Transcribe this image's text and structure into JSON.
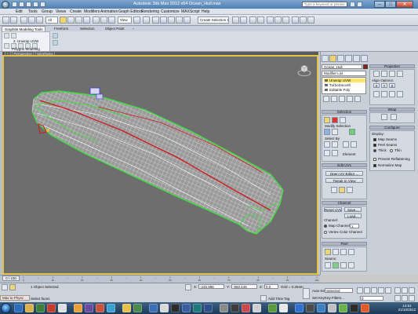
{
  "window": {
    "title": "Autodesk 3ds Max 2012 x64    Ocean_Hull.max",
    "search_placeholder": "Type a keyword or phrase",
    "controls": {
      "minimize": "–",
      "maximize": "□",
      "close": "✕"
    }
  },
  "menu": {
    "items": [
      "Edit",
      "Tools",
      "Group",
      "Views",
      "Create",
      "Modifiers",
      "Animation",
      "Graph Editors",
      "Rendering",
      "Customize",
      "MAXScript",
      "Help"
    ]
  },
  "toolbar": {
    "filter_select": "All",
    "view_select": "View",
    "selection_set": "Create Selection Se"
  },
  "ribbon": {
    "tabs": [
      "Graphite Modeling Tools",
      "Freeform",
      "Selection",
      "Object Paint"
    ],
    "panel_label": "Polygon Modeling",
    "panel_value": "2. Unwrap UVW"
  },
  "viewport": {
    "label": "[ + ] [ Perspective ] [ Wireframe ]"
  },
  "command_panel": {
    "object_name": "Ocean_Hull",
    "modifier_list": "Modifier List",
    "stack": [
      "Unwrap UVW",
      "TurboSmooth",
      "Editable Poly"
    ],
    "selection": {
      "head": "Selection",
      "modify_selection": "Modify Selection",
      "select_by": "Select By",
      "element": "Element"
    },
    "edit_uvs": {
      "head": "Edit UVs",
      "open_editor": "Open UV Editor ...",
      "tweak": "Tweak In View"
    },
    "channel": {
      "head": "Channel",
      "reset": "Reset UVWs",
      "save": "Save...",
      "load": "Load...",
      "channel_label": "Channel:",
      "map_channel": "Map Channel:",
      "map_value": "1",
      "vertex_color": "Vertex Color Channel"
    },
    "peel": {
      "head": "Peel",
      "seams": "Seams:"
    },
    "projection": {
      "head": "Projection",
      "align_options": "Align Options:"
    },
    "wrap": {
      "head": "Wrap"
    },
    "configure": {
      "head": "Configure",
      "display": "Display:",
      "map_seams": "Map Seams",
      "peel_seams": "Peel Seams",
      "thick": "Thick",
      "thin": "Thin",
      "prevent": "Prevent Reflattening",
      "normalize": "Normalize Map"
    }
  },
  "timeline": {
    "slider": "0 / 100",
    "ticks": [
      "0",
      "10",
      "20",
      "30",
      "40",
      "50",
      "60",
      "70",
      "80",
      "90",
      "100"
    ]
  },
  "status": {
    "maxscript": "Max to Physc",
    "objects_selected": "1 Object Selected",
    "prompt": "Select faces",
    "x_label": "X:",
    "x_value": "-245.996",
    "y_label": "Y:",
    "y_value": "-560.145",
    "z_label": "Z:",
    "z_value": "0.0",
    "grid": "Grid = 0.254m",
    "add_time_tag": "Add Time Tag",
    "autokey": "Auto Key",
    "selected": "Selected",
    "setkey": "Set Key",
    "key_filters": "Key Filters...",
    "frame": "0"
  },
  "taskbar": {
    "time": "14:51",
    "date": "21/10/2012"
  }
}
